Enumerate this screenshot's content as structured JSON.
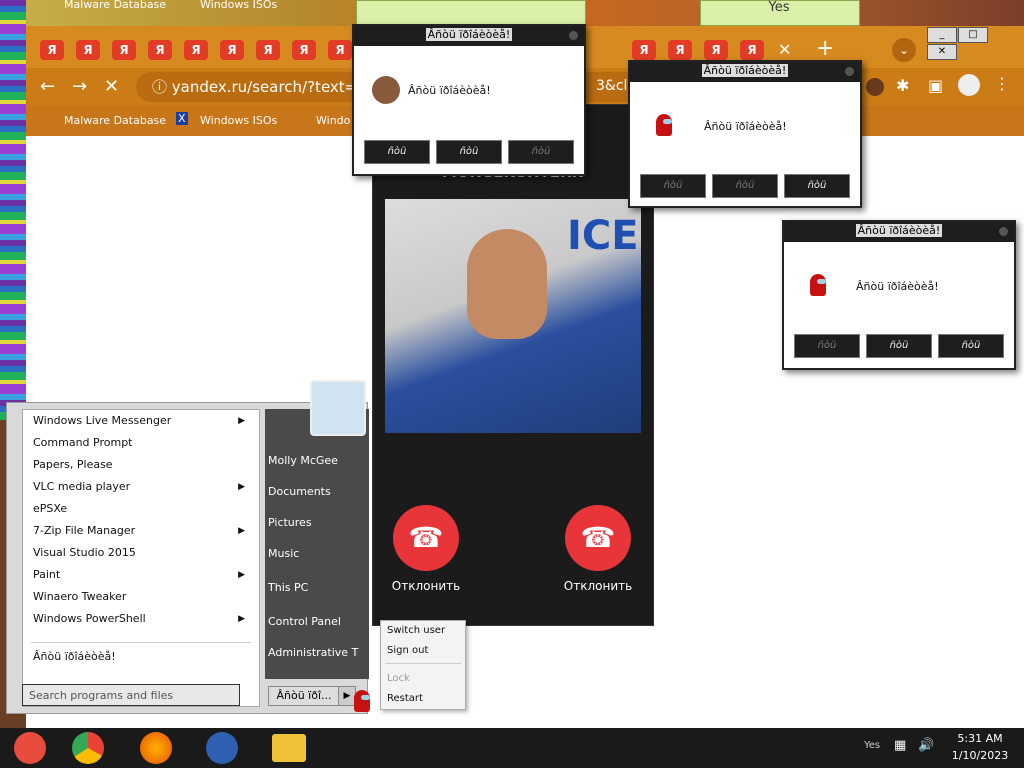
{
  "top_strip": {
    "bm1": "Malware Database",
    "bm2": "Windows ISOs",
    "yes": "Yes"
  },
  "browser": {
    "url": "yandex.ru/search/?text=Ta",
    "url_tail": "3&clid=",
    "bookmarks": [
      "Malware Database",
      "Windows ISOs",
      "Windo"
    ],
    "tab_new": "+"
  },
  "start_menu": {
    "programs": [
      {
        "label": "Windows Live Messenger",
        "arrow": true
      },
      {
        "label": "Command Prompt",
        "arrow": false
      },
      {
        "label": "Papers, Please",
        "arrow": false
      },
      {
        "label": "VLC media player",
        "arrow": true
      },
      {
        "label": "ePSXe",
        "arrow": false
      },
      {
        "label": "7-Zip File Manager",
        "arrow": true
      },
      {
        "label": "Visual Studio 2015",
        "arrow": false
      },
      {
        "label": "Paint",
        "arrow": true
      },
      {
        "label": "Winaero Tweaker",
        "arrow": false
      },
      {
        "label": "Windows PowerShell",
        "arrow": true
      }
    ],
    "all_programs": "Âñòü ïðîáèòèå!",
    "search_placeholder": "Search programs and files",
    "right_items": [
      "Molly McGee",
      "Documents",
      "Pictures",
      "Music",
      "This PC",
      "Control Panel",
      "Administrative T"
    ],
    "shutdown": "Âñòü ïðî...",
    "power_menu": [
      "Switch user",
      "Sign out",
      "Lock",
      "Restart"
    ]
  },
  "call": {
    "caller": "MORGENSHTERN",
    "photo_text": "ICE",
    "decline1": "Отклонить",
    "decline2": "Отклонить"
  },
  "popups": [
    {
      "title": "Âñòü ïðîáèòèå!",
      "message": "Âñòü ïðîáèòèå!",
      "buttons": [
        "ñòü ïðîáèòèå",
        "ñòü ïðîáèòèå",
        "ñòü ïðîáèòèå"
      ]
    },
    {
      "title": "Âñòü ïðîáèòèå!",
      "message": "Âñòü ïðîáèòèå!",
      "buttons": [
        "ñòü ïðîáèòèå",
        "ñòü ïðîáèòèå",
        "ñòü ïðîáèòèå"
      ]
    },
    {
      "title": "Âñòü ïðîáèòèå!",
      "message": "Âñòü ïðîáèòèå!",
      "buttons": [
        "ñòü ïðîáèòèå",
        "ñòü ïðîáèòèå",
        "ñòü ïðîáèòèå"
      ]
    }
  ],
  "taskbar": {
    "time": "5:31 AM",
    "date": "1/10/2023",
    "tray_label": "Yes"
  },
  "colors": {
    "decline": "#e8353a",
    "browser_chrome": "#d78a1f",
    "popup_bar": "#1e1e1e"
  }
}
